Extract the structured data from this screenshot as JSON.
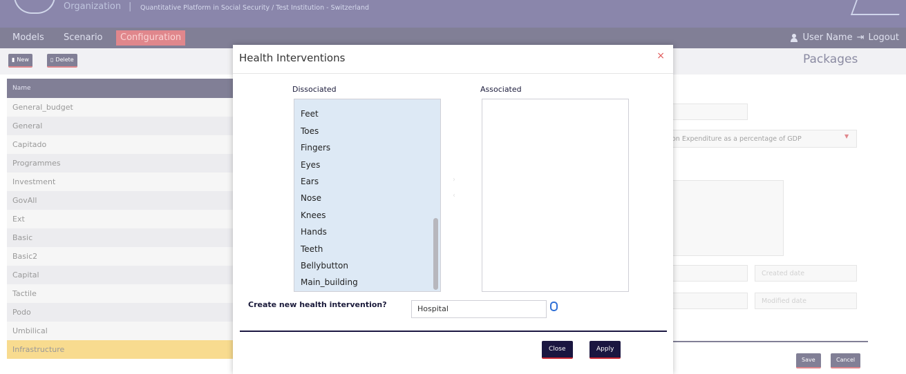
{
  "header": {
    "org_text": "Organization",
    "separator": "|",
    "subtitle": "Quantitative Platform in Social Security / Test Institution - Switzerland"
  },
  "nav": {
    "items": [
      {
        "label": "Models",
        "active": false
      },
      {
        "label": "Scenario",
        "active": false
      },
      {
        "label": "Configuration",
        "active": true
      }
    ],
    "user_name": "User Name",
    "logout_label": "Logout"
  },
  "toolbar": {
    "new_label": "New",
    "delete_label": "Delete",
    "packages_title": "Packages"
  },
  "list": {
    "header": "Name",
    "rows": [
      "General_budget",
      "General",
      "Capitado",
      "Programmes",
      "Investment",
      "GovAll",
      "Ext",
      "Basic",
      "Basic2",
      "Capital",
      "Tactile",
      "Podo",
      "Umbilical",
      "Infrastructure"
    ],
    "selected": "Infrastructure"
  },
  "form_bg": {
    "select_value": "on Expenditure as a percentage of GDP",
    "created_placeholder": "Created date",
    "modified_placeholder": "Modified date",
    "save_label": "Save",
    "cancel_label": "Cancel"
  },
  "modal": {
    "title": "Health Interventions",
    "close_symbol": "×",
    "dissociated_label": "Dissociated",
    "associated_label": "Associated",
    "dissociated_items": [
      "Feet",
      "Toes",
      "Fingers",
      "Eyes",
      "Ears",
      "Nose",
      "Knees",
      "Hands",
      "Teeth",
      "Bellybutton",
      "Main_building"
    ],
    "associated_items": [],
    "move_right_symbol": "›",
    "move_left_symbol": "‹",
    "create_label": "Create new health intervention?",
    "create_value": "Hospital",
    "close_button": "Close",
    "apply_button": "Apply"
  },
  "colors": {
    "header_bg": "#2a2466",
    "nav_bg": "#1a1640",
    "accent_red": "#c7252f",
    "selected_row": "#f2bd34",
    "listbox_bg": "#dde9f5"
  }
}
